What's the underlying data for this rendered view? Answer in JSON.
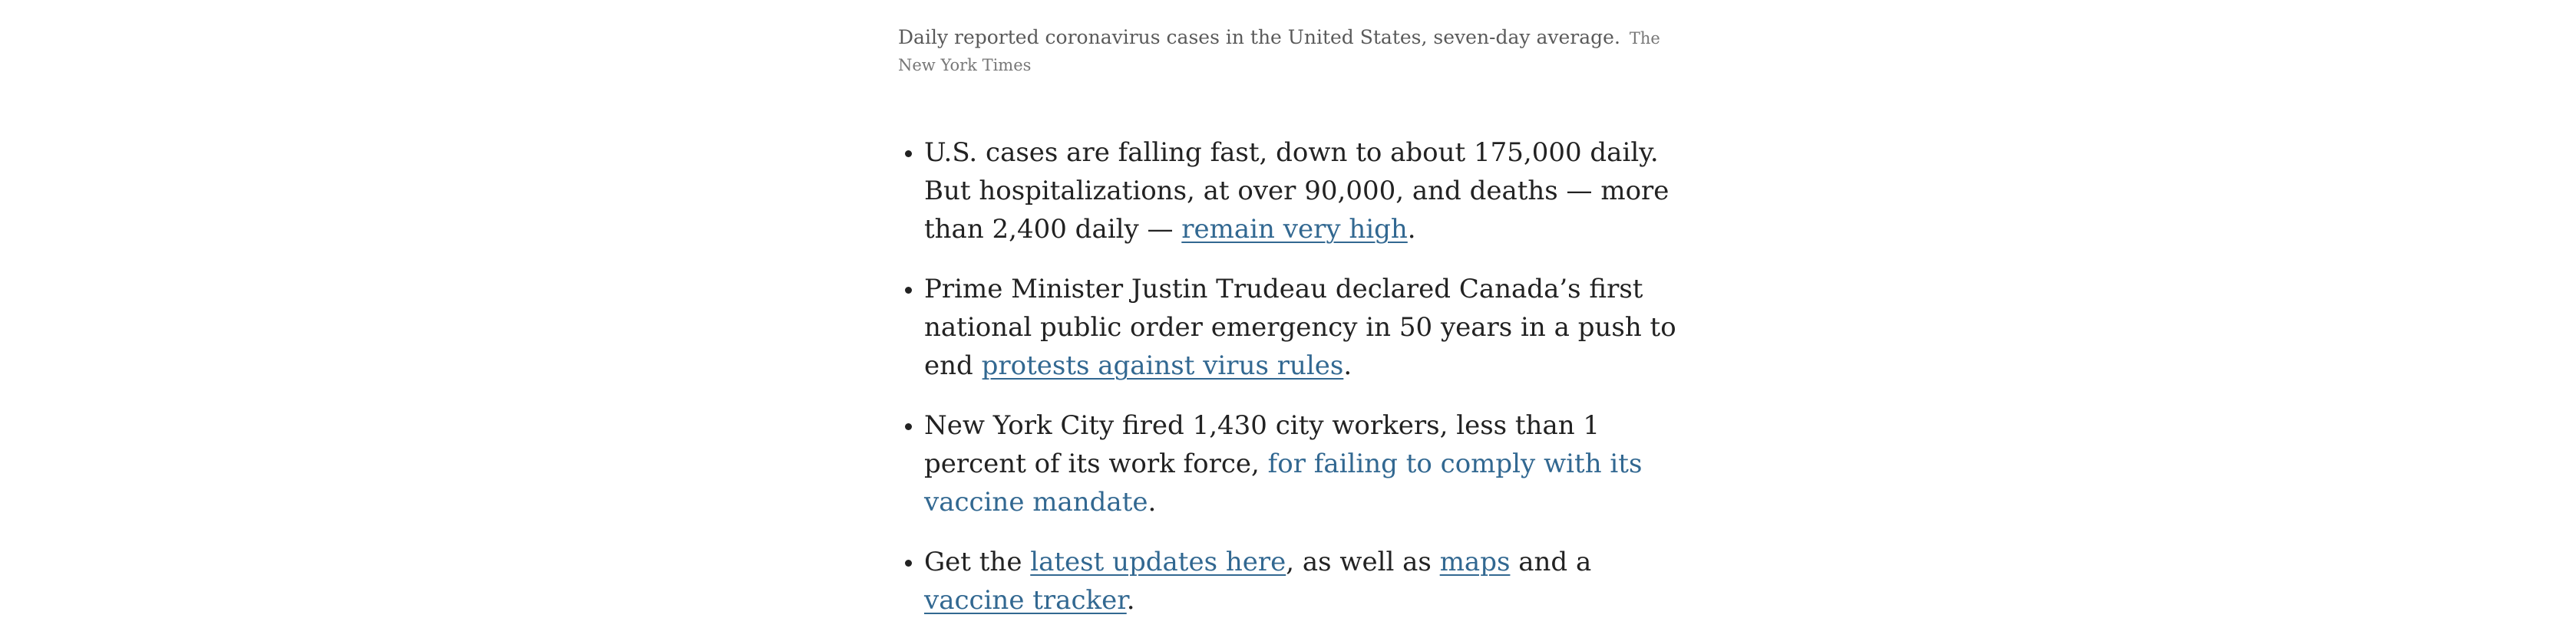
{
  "caption": {
    "text": "Daily reported coronavirus cases in the United States, seven-day average.",
    "credit": "The New York Times"
  },
  "bullets": [
    {
      "parts": [
        {
          "text": "U.S. cases are falling fast, down to about 175,000 daily. But hospitalizations, at over 90,000, and deaths — more than 2,400 daily — "
        },
        {
          "link": "remain very high"
        },
        {
          "text": "."
        }
      ]
    },
    {
      "parts": [
        {
          "text": "Prime Minister Justin Trudeau declared Canada’s first national public order emergency in 50 years in a push to end "
        },
        {
          "link": "protests against virus rules"
        },
        {
          "text": "."
        }
      ]
    },
    {
      "parts": [
        {
          "text": "New York City fired 1,430 city workers, less than 1 percent of its work force, "
        },
        {
          "link": "for failing to comply with its vaccine mandate"
        },
        {
          "text": "."
        }
      ]
    },
    {
      "parts": [
        {
          "text": "Get the "
        },
        {
          "link": "latest updates here"
        },
        {
          "text": ", as well as "
        },
        {
          "link": "maps"
        },
        {
          "text": " and a "
        },
        {
          "link": "vaccine tracker"
        },
        {
          "text": "."
        }
      ]
    }
  ],
  "colors": {
    "link": "#326891",
    "body_text": "#222222",
    "caption_text": "#5a5a5a"
  }
}
